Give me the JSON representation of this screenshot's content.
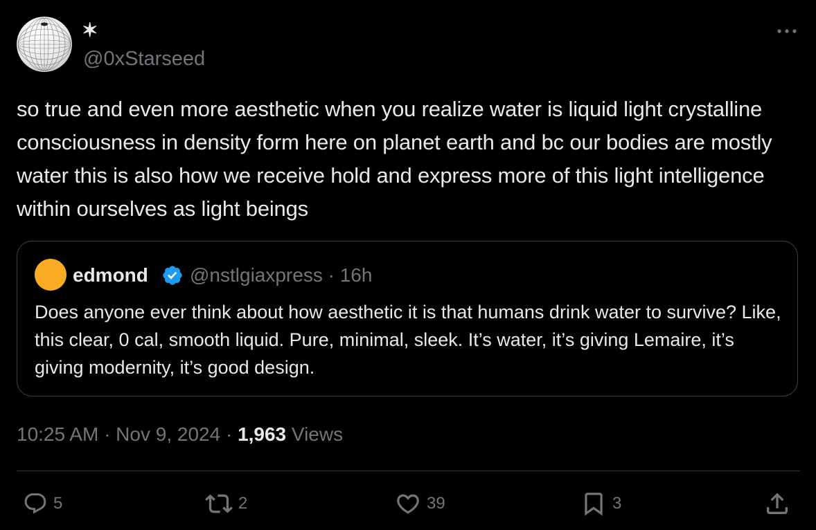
{
  "author": {
    "display_name": "✶",
    "handle": "@0xStarseed",
    "avatar_icon": "wireframe-sphere-avatar"
  },
  "menu": {
    "more_icon": "more-horizontal-icon"
  },
  "tweet": {
    "text": "so true and even more aesthetic when you realize water is liquid light crystalline consciousness in density form here on planet earth and bc our bodies are mostly water this is also how we receive hold and express more of this light intelligence within ourselves as light beings"
  },
  "quote": {
    "display_name": "edmond",
    "verified": true,
    "verified_color": "#1d9bf0",
    "avatar_color": "#f9ac23",
    "meta": "@nstlgiaxpress · 16h",
    "text": "Does anyone ever think about how aesthetic it is that humans drink water to survive? Like, this clear, 0 cal, smooth liquid. Pure, minimal, sleek. It’s water, it’s giving Lemaire, it’s giving modernity, it’s good design."
  },
  "meta": {
    "timestamp": "10:25 AM · Nov 9, 2024 · ",
    "views_count": "1,963",
    "views_label": " Views"
  },
  "actions": {
    "reply_count": "5",
    "repost_count": "2",
    "like_count": "39",
    "bookmark_count": "3"
  },
  "colors": {
    "background": "#000000",
    "text_primary": "#e7e9ea",
    "text_secondary": "#71767b",
    "border": "#2f3336"
  }
}
